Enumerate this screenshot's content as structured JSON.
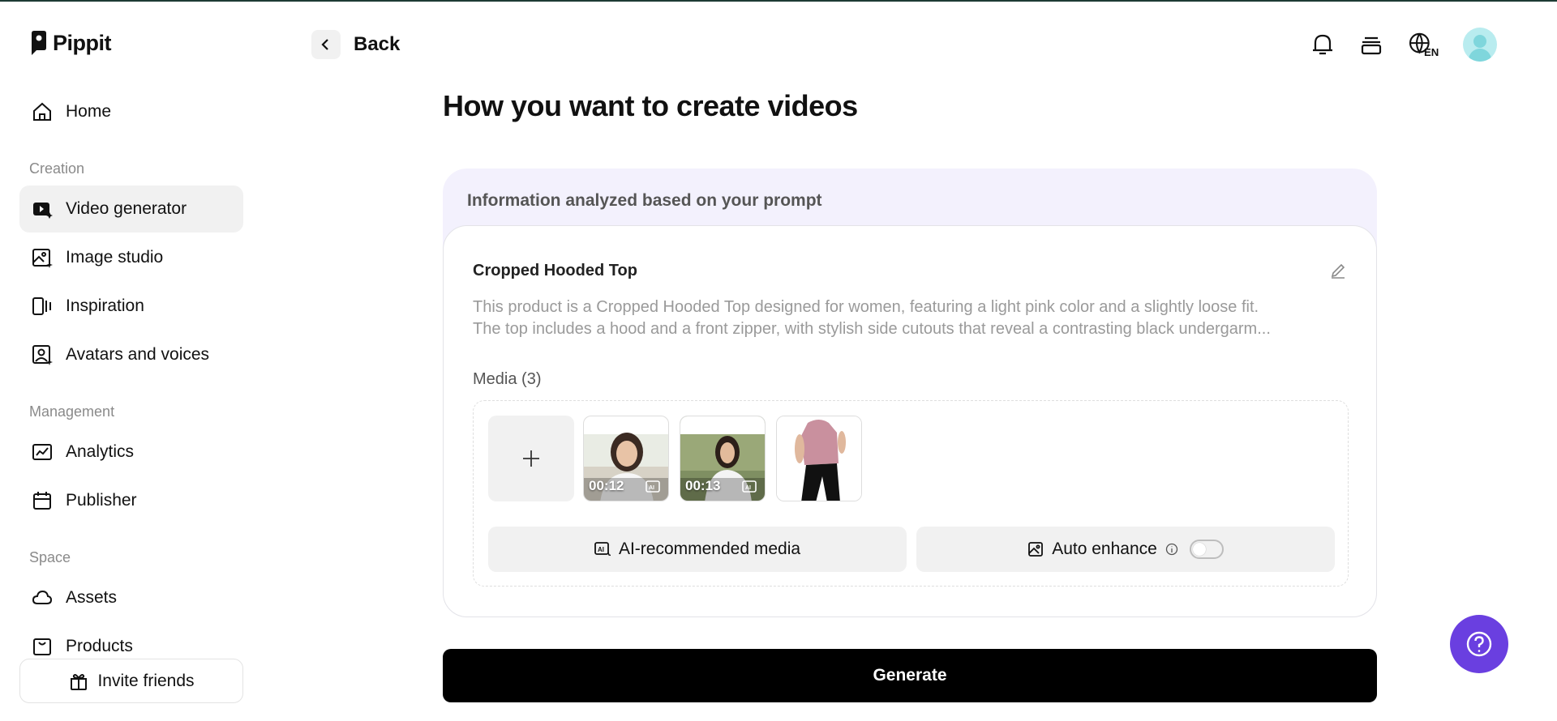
{
  "brand": {
    "name": "Pippit"
  },
  "header": {
    "back_label": "Back",
    "language": "EN"
  },
  "sidebar": {
    "home": "Home",
    "sections": [
      {
        "label": "Creation",
        "items": [
          "Video generator",
          "Image studio",
          "Inspiration",
          "Avatars and voices"
        ]
      },
      {
        "label": "Management",
        "items": [
          "Analytics",
          "Publisher"
        ]
      },
      {
        "label": "Space",
        "items": [
          "Assets",
          "Products"
        ]
      }
    ],
    "active_item": "Video generator",
    "invite_label": "Invite friends"
  },
  "main": {
    "title": "How you want to create videos",
    "card_header": "Information analyzed based on your prompt",
    "product_name": "Cropped Hooded Top",
    "description_line1": "This product is a Cropped Hooded Top designed for women, featuring a light pink color and a slightly loose fit.",
    "description_line2": "The top includes a hood and a front zipper, with stylish side cutouts that reveal a contrasting black undergarm...",
    "media_label": "Media (3)",
    "media": [
      {
        "type": "video",
        "duration": "00:12"
      },
      {
        "type": "video",
        "duration": "00:13"
      },
      {
        "type": "image"
      }
    ],
    "ai_media_label": "AI-recommended media",
    "auto_enhance_label": "Auto enhance",
    "auto_enhance_on": false,
    "generate_label": "Generate"
  },
  "colors": {
    "accent": "#6a3fe0",
    "active_bg": "#f1f1f1",
    "card_bg": "#f3f1fd"
  }
}
